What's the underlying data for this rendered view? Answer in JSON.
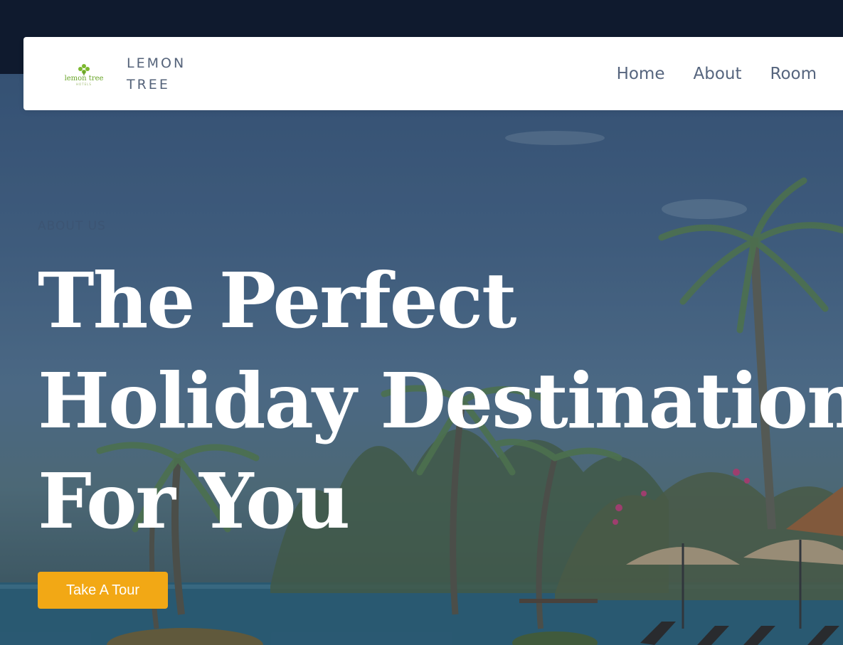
{
  "header": {
    "logo_text": "lemon tree",
    "logo_subtext": "HOTELS",
    "brand_line1": "LEMON",
    "brand_line2": "TREE",
    "nav": [
      {
        "label": "Home"
      },
      {
        "label": "About"
      },
      {
        "label": "Room"
      }
    ]
  },
  "hero": {
    "eyebrow": "ABOUT US",
    "headline_line1": "The Perfect",
    "headline_line2": "Holiday Destination",
    "headline_line3": "For You",
    "cta_label": "Take A Tour"
  },
  "colors": {
    "top_band": "#0f1a2e",
    "accent": "#f2a815",
    "nav_text": "#56657e",
    "logo_green": "#7cb82f"
  },
  "icons": [
    "lemon-tree-logo",
    "palm-trees-background"
  ]
}
